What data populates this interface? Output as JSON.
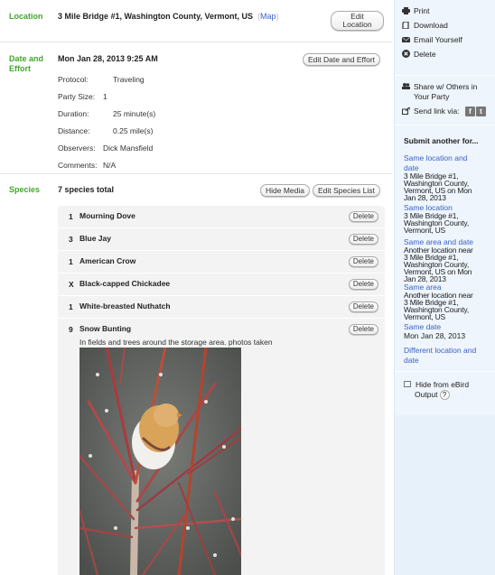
{
  "location": {
    "label": "Location",
    "value": "3 Mile Bridge #1, Washington County, Vermont, US",
    "map_link": "Map",
    "edit_button_line1": "Edit",
    "edit_button_line2": "Location"
  },
  "date_effort": {
    "label_line1": "Date and",
    "label_line2": "Effort",
    "datetime": "Mon Jan 28, 2013 9:25 AM",
    "edit_button": "Edit Date and Effort",
    "fields": [
      {
        "key": "Protocol:",
        "value": "Traveling"
      },
      {
        "key": "Party Size:",
        "value": "1"
      },
      {
        "key": "Duration:",
        "value": "25 minute(s)"
      },
      {
        "key": "Distance:",
        "value": "0.25 mile(s)"
      },
      {
        "key": "Observers:",
        "value": "Dick Mansfield"
      },
      {
        "key": "Comments:",
        "value": "N/A"
      }
    ]
  },
  "species": {
    "label": "Species",
    "total": "7 species total",
    "hide_media_button": "Hide Media",
    "edit_list_button": "Edit Species List",
    "delete_label": "Delete",
    "items": [
      {
        "count": "1",
        "name": "Mourning Dove"
      },
      {
        "count": "3",
        "name": "Blue Jay"
      },
      {
        "count": "1",
        "name": "American Crow"
      },
      {
        "count": "X",
        "name": "Black-capped Chickadee"
      },
      {
        "count": "1",
        "name": "White-breasted Nuthatch"
      },
      {
        "count": "9",
        "name": "Snow Bunting",
        "comment": "In fields and trees around the storage area. photos taken",
        "photo": "snow-bunting-in-red-twigs"
      }
    ]
  },
  "sidebar": {
    "actions": [
      {
        "icon": "print-icon",
        "label": "Print"
      },
      {
        "icon": "download-icon",
        "label": "Download"
      },
      {
        "icon": "email-icon",
        "label": "Email Yourself"
      },
      {
        "icon": "delete-icon",
        "label": "Delete"
      }
    ],
    "share_line1": "Share w/ Others in",
    "share_line2": "Your Party",
    "send_link": "Send link via:",
    "facebook": "f",
    "twitter": "t",
    "submit_heading": "Submit another for...",
    "submit_options": [
      {
        "link_line1": "Same location and",
        "link_line2": "date",
        "sub": [
          "3 Mile Bridge #1,",
          "Washington County,",
          "Vermont, US on Mon",
          "Jan 28, 2013"
        ]
      },
      {
        "link_line1": "Same location",
        "sub": [
          "3 Mile Bridge #1,",
          "Washington County,",
          "Vermont, US"
        ]
      },
      {
        "link_line1": "Same area and date",
        "sub": [
          "Another location near",
          "3 Mile Bridge #1,",
          "Washington County,",
          "Vermont, US on Mon",
          "Jan 28, 2013"
        ]
      },
      {
        "link_line1": "Same area",
        "sub": [
          "Another location near",
          "3 Mile Bridge #1,",
          "Washington County,",
          "Vermont, US"
        ]
      },
      {
        "link_line1": "Same date",
        "sub": [
          "Mon Jan 28, 2013"
        ]
      },
      {
        "link_line1": "Different location and",
        "link_line2": "date"
      }
    ],
    "hide_line1": "Hide from eBird",
    "hide_line2": "Output",
    "help": "?"
  }
}
